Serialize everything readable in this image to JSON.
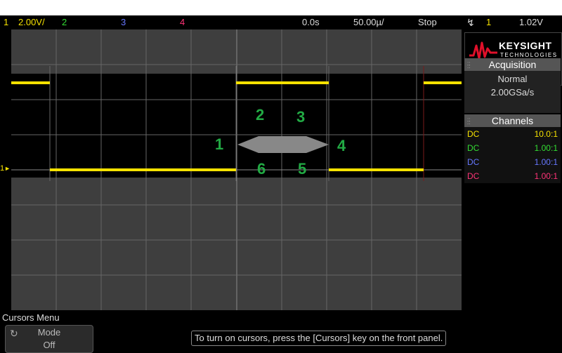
{
  "status": {
    "ch1_num": "1",
    "ch1_scale": "2.00V/",
    "ch2_num": "2",
    "ch3_num": "3",
    "ch4_num": "4",
    "time_delay": "0.0s",
    "time_scale": "50.00µ/",
    "run_state": "Stop",
    "trigger_icon": "rising-edge-trigger-icon",
    "trigger_source": "1",
    "trigger_level": "1.02V"
  },
  "brand": {
    "name": "KEYSIGHT",
    "sub": "TECHNOLOGIES"
  },
  "acquisition": {
    "title": "Acquisition",
    "mode": "Normal",
    "rate": "2.00GSa/s"
  },
  "channels": {
    "title": "Channels",
    "rows": [
      {
        "coupling": "DC",
        "probe": "10.0:1",
        "color": "#f5e100"
      },
      {
        "coupling": "DC",
        "probe": "1.00:1",
        "color": "#33dd33"
      },
      {
        "coupling": "DC",
        "probe": "1.00:1",
        "color": "#6677ff"
      },
      {
        "coupling": "DC",
        "probe": "1.00:1",
        "color": "#ff3377"
      }
    ]
  },
  "annotations": [
    "1",
    "2",
    "3",
    "4",
    "5",
    "6"
  ],
  "ch1_marker": "1",
  "menu": {
    "title": "Cursors Menu",
    "softkey_label": "Mode",
    "softkey_value": "Off",
    "hint": "To turn on cursors, press the [Cursors] key on the front panel."
  },
  "colors": {
    "ch1": "#f5e100",
    "ch2": "#33dd33",
    "ch3": "#6677ff",
    "ch4": "#ff3377",
    "trigger_marker": "#f0a020",
    "annotation": "#22aa44"
  }
}
